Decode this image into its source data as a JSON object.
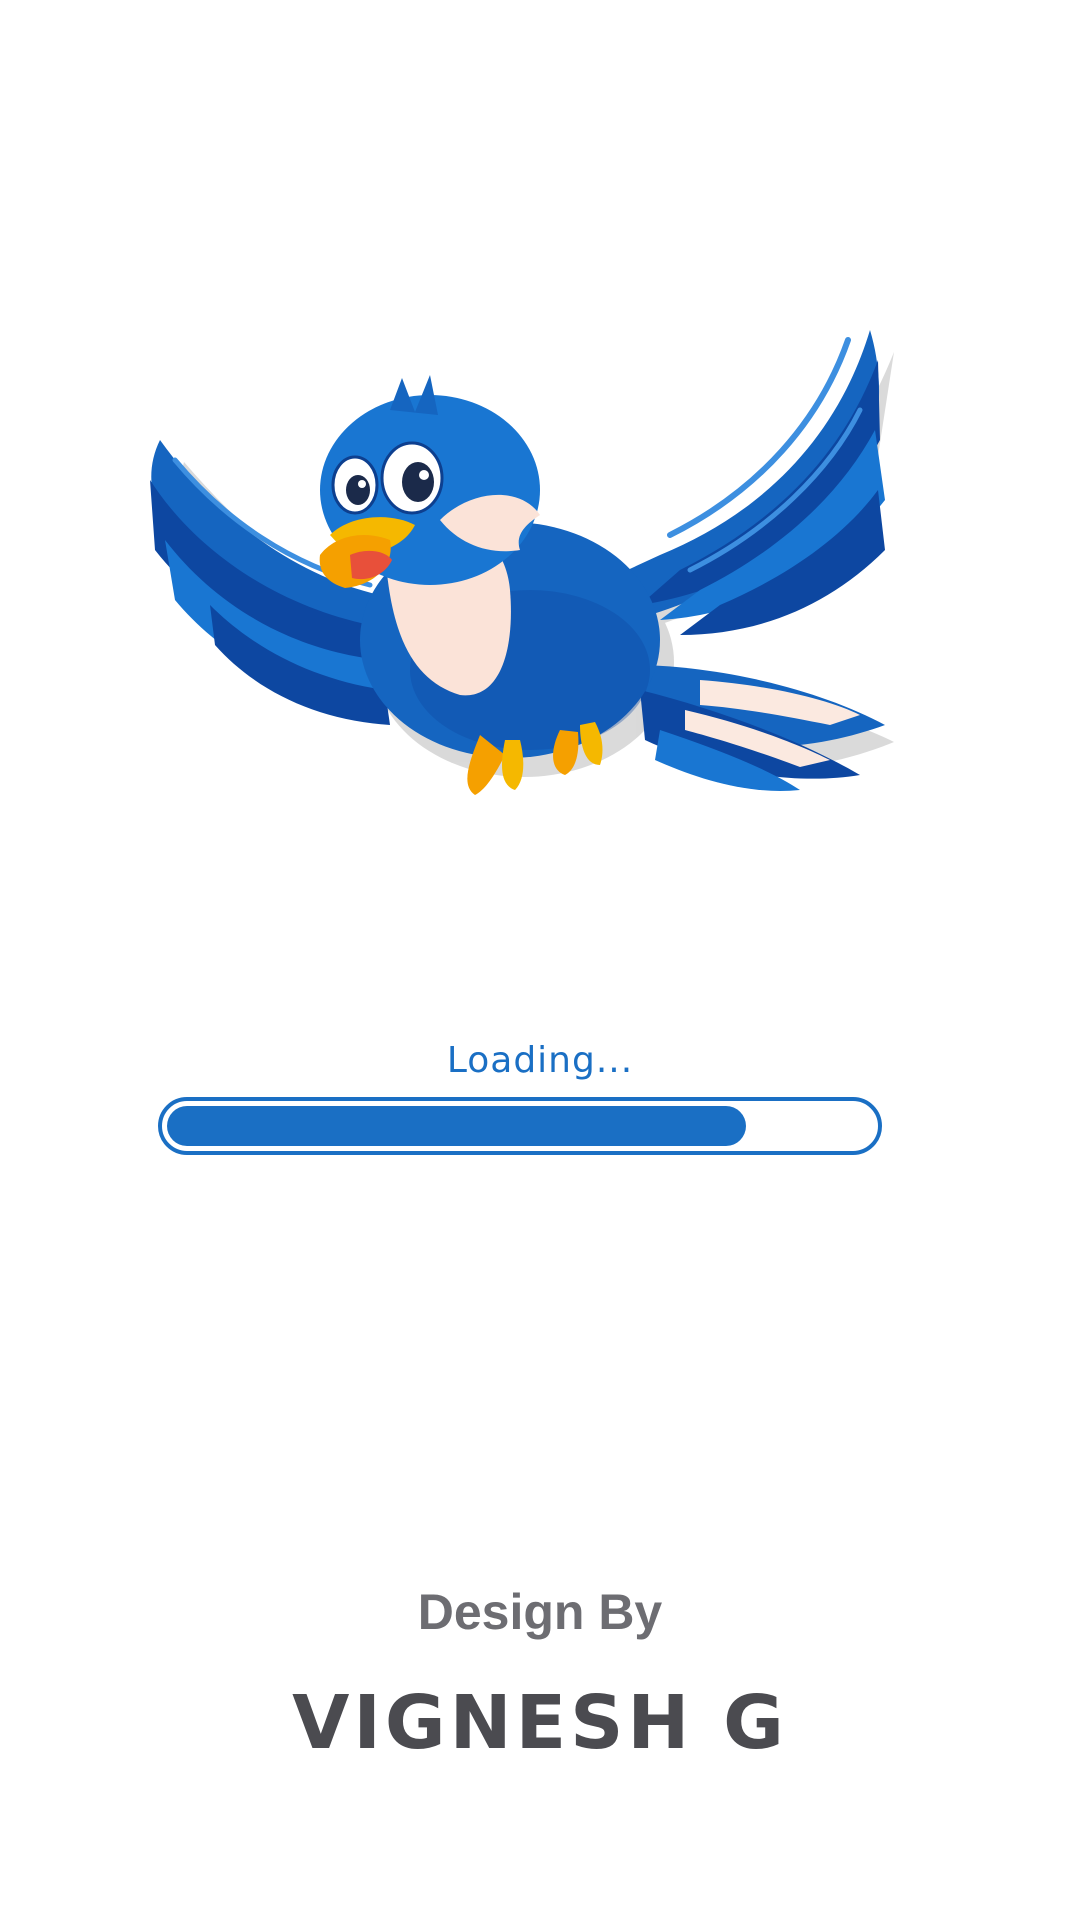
{
  "splash": {
    "illustration_icon": "blue-bird-icon",
    "loading_text": "Loading...",
    "progress_percent": 82,
    "design_by_label": "Design By",
    "designer_name": "VIGNESH G"
  },
  "colors": {
    "accent": "#1a6fc4",
    "bird_blue": "#1565c0",
    "bird_dark": "#0d47a1",
    "bird_light": "#2f80d8",
    "beak": "#f5b800",
    "design_by": "#6d6d72",
    "name": "#4b4b50"
  }
}
